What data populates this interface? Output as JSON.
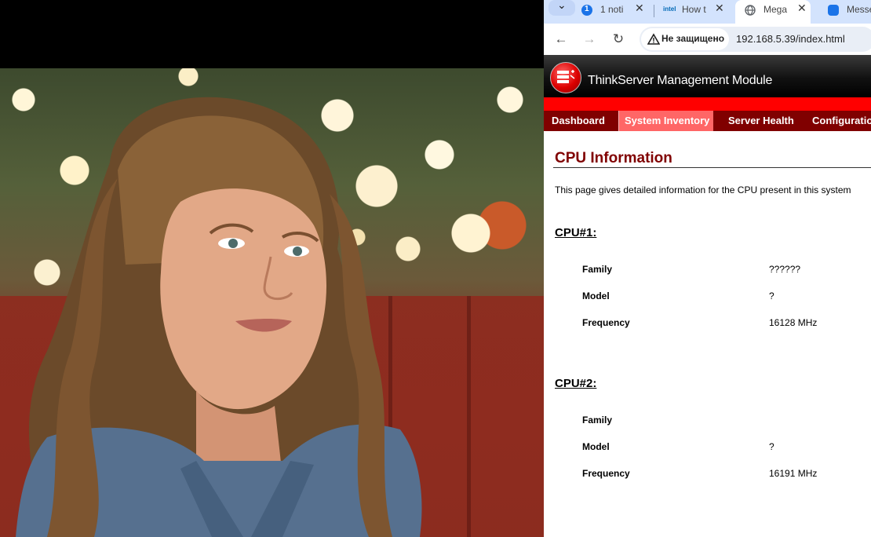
{
  "browser": {
    "tabs": [
      {
        "badge": "1",
        "label": "1 noti",
        "icon": "notification-badge-icon"
      },
      {
        "label": "How t",
        "icon": "intel-icon",
        "icon_text": "intel"
      },
      {
        "label": "Mega",
        "icon": "globe-icon",
        "active": true
      },
      {
        "label": "Messe",
        "icon": "chat-icon"
      }
    ],
    "address": {
      "security_text": "Не защищено",
      "url": "192.168.5.39/index.html"
    }
  },
  "app": {
    "title": "ThinkServer Management Module",
    "nav": [
      "Dashboard",
      "System Inventory",
      "Server Health",
      "Configuration"
    ],
    "active_nav": "System Inventory"
  },
  "page": {
    "title": "CPU Information",
    "intro": "This page gives detailed information for the CPU present in this system",
    "cpus": [
      {
        "heading": "CPU#1:",
        "rows": [
          {
            "label": "Family",
            "value": "??????"
          },
          {
            "label": "Model",
            "value": "?"
          },
          {
            "label": "Frequency",
            "value": "16128 MHz"
          }
        ]
      },
      {
        "heading": "CPU#2:",
        "rows": [
          {
            "label": "Family",
            "value": ""
          },
          {
            "label": "Model",
            "value": "?"
          },
          {
            "label": "Frequency",
            "value": "16191 MHz"
          }
        ]
      }
    ]
  },
  "colors": {
    "nav_bg": "#800000",
    "nav_active": "#ff6666",
    "red_bar": "#ff0000",
    "title_color": "#800000",
    "tabstrip": "#d3e3fd"
  }
}
